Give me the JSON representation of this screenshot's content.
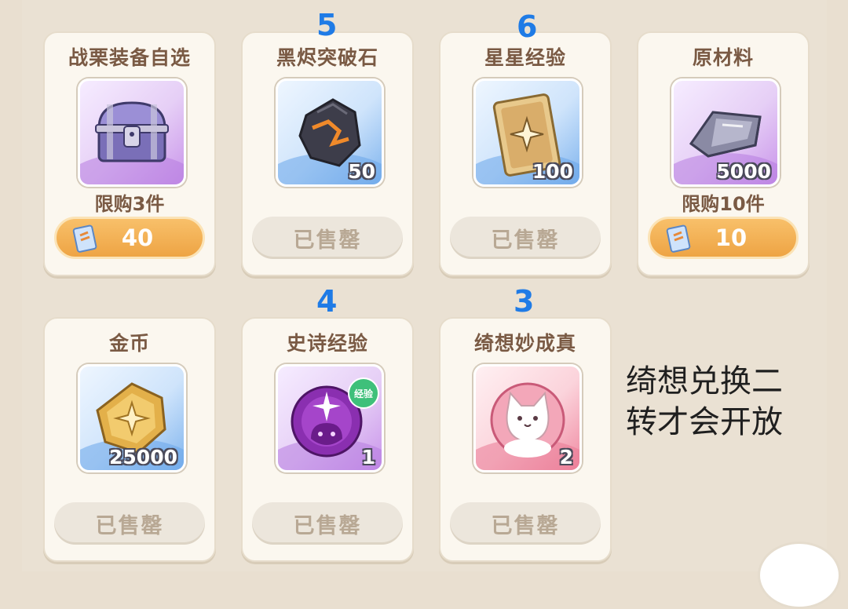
{
  "cards": [
    {
      "title": "战栗装备自选",
      "qty": "",
      "limit": "限购3件",
      "button": {
        "type": "buy",
        "label": "40"
      },
      "icon": "treasure-chest-icon"
    },
    {
      "title": "黑烬突破石",
      "qty": "50",
      "limit": "",
      "button": {
        "type": "sold",
        "label": "已售罄"
      },
      "icon": "black-ember-stone-icon"
    },
    {
      "title": "星星经验",
      "qty": "100",
      "limit": "",
      "button": {
        "type": "sold",
        "label": "已售罄"
      },
      "icon": "star-card-icon"
    },
    {
      "title": "原材料",
      "qty": "5000",
      "limit": "限购10件",
      "button": {
        "type": "buy",
        "label": "10"
      },
      "icon": "metal-ingot-icon"
    },
    {
      "title": "金币",
      "qty": "25000",
      "limit": "",
      "button": {
        "type": "sold",
        "label": "已售罄"
      },
      "icon": "gold-coin-icon"
    },
    {
      "title": "史诗经验",
      "qty": "1",
      "limit": "",
      "badge": "经验",
      "button": {
        "type": "sold",
        "label": "已售罄"
      },
      "icon": "epic-exp-orb-icon"
    },
    {
      "title": "绮想妙成真",
      "qty": "2",
      "limit": "",
      "button": {
        "type": "sold",
        "label": "已售罄"
      },
      "icon": "white-cat-icon"
    }
  ],
  "markers": [
    "5",
    "6",
    "4",
    "3"
  ],
  "note": {
    "line1": "绮想兑换二",
    "line2": "转才会开放"
  },
  "colors": {
    "marker": "#1f7be6",
    "buy_button": "#eea444",
    "sold_text": "#b8a894",
    "title_text": "#7a5a44"
  }
}
